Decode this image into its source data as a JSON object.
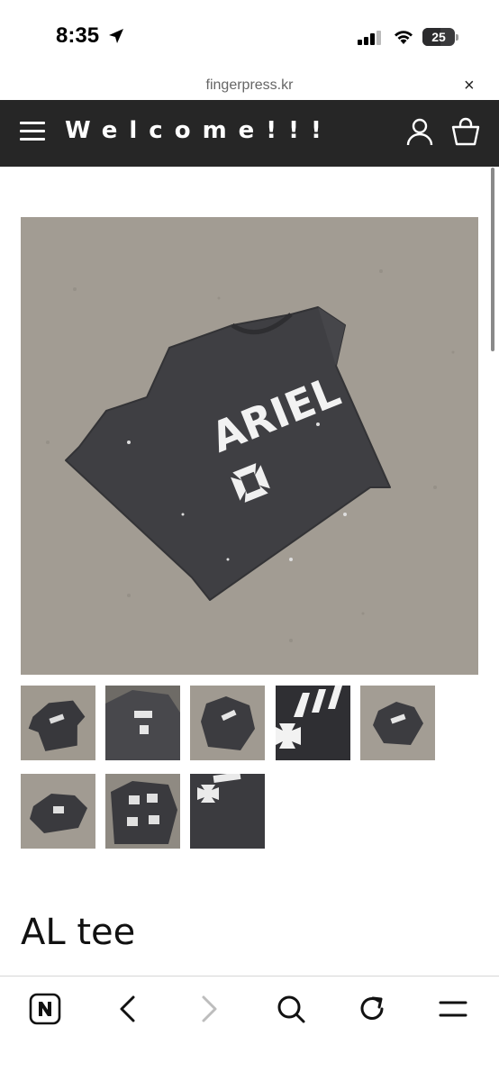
{
  "status_bar": {
    "time": "8:35",
    "battery": "25"
  },
  "browser": {
    "url": "fingerpress.kr",
    "close_glyph": "×"
  },
  "header": {
    "brand": "Welcome!!!"
  },
  "product": {
    "title": "AL tee",
    "main_image": {
      "print_text": "ARIEL"
    },
    "thumbnail_count": 8
  },
  "icons": [
    "location-arrow-icon",
    "signal-icon",
    "wifi-icon",
    "battery-icon",
    "close-icon",
    "menu-icon",
    "user-icon",
    "shopping-bag-icon",
    "naver-icon",
    "back-icon",
    "forward-icon",
    "search-icon",
    "reload-icon",
    "tabs-menu-icon"
  ],
  "colors": {
    "header_bg": "#262626",
    "shirt": "#3e3e42",
    "ground": "#a09a91"
  }
}
